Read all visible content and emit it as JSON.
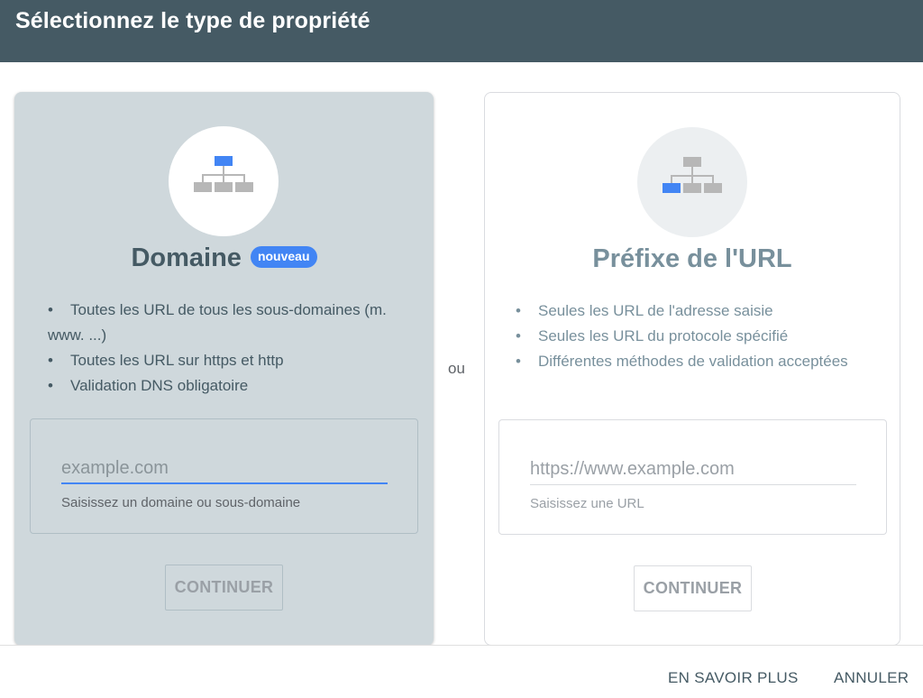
{
  "header": {
    "title": "Sélectionnez le type de propriété"
  },
  "domain_card": {
    "title": "Domaine",
    "badge": "nouveau",
    "bullets": [
      "Toutes les URL de tous les sous-domaines (m. www. ...)",
      "Toutes les URL sur https et http",
      "Validation DNS obligatoire"
    ],
    "input_placeholder": "example.com",
    "input_value": "",
    "helper": "Saisissez un domaine ou sous-domaine",
    "button": "CONTINUER"
  },
  "or_label": "ou",
  "url_card": {
    "title": "Préfixe de l'URL",
    "bullets": [
      "Seules les URL de l'adresse saisie",
      "Seules les URL du protocole spécifié",
      "Différentes méthodes de validation acceptées"
    ],
    "input_placeholder": "https://www.example.com",
    "input_value": "",
    "helper": "Saisissez une URL",
    "button": "CONTINUER"
  },
  "footer": {
    "learn_more": "EN SAVOIR PLUS",
    "cancel": "ANNULER"
  },
  "icons": {
    "domain": "sitemap-icon",
    "url_prefix": "sitemap-icon"
  },
  "colors": {
    "accent": "#4285f4",
    "header_bg": "#455a64",
    "selected_card_bg": "#cfd8dc"
  }
}
